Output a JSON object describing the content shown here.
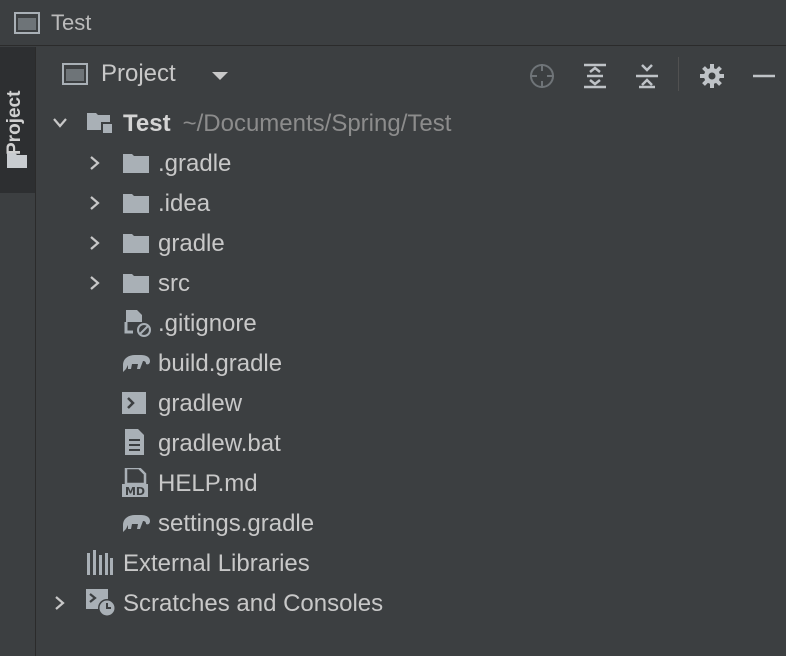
{
  "window": {
    "title": "Test"
  },
  "side_tab": {
    "label": "Project"
  },
  "toolbar": {
    "view_label": "Project"
  },
  "tree": {
    "root": {
      "name": "Test",
      "path": "~/Documents/Spring/Test"
    },
    "items": [
      {
        "label": ".gradle",
        "icon": "folder-icon",
        "expandable": true
      },
      {
        "label": ".idea",
        "icon": "folder-icon",
        "expandable": true
      },
      {
        "label": "gradle",
        "icon": "folder-icon",
        "expandable": true
      },
      {
        "label": "src",
        "icon": "folder-icon",
        "expandable": true
      },
      {
        "label": ".gitignore",
        "icon": "ignore-file-icon",
        "expandable": false
      },
      {
        "label": "build.gradle",
        "icon": "gradle-elephant-icon",
        "expandable": false
      },
      {
        "label": "gradlew",
        "icon": "shell-script-icon",
        "expandable": false
      },
      {
        "label": "gradlew.bat",
        "icon": "text-file-icon",
        "expandable": false
      },
      {
        "label": "HELP.md",
        "icon": "markdown-file-icon",
        "expandable": false
      },
      {
        "label": "settings.gradle",
        "icon": "gradle-elephant-icon",
        "expandable": false
      }
    ],
    "external_libraries": "External Libraries",
    "scratches": "Scratches and Consoles"
  },
  "colors": {
    "background": "#3c3f41",
    "text": "#c8c8c8",
    "path": "#8c8c8c",
    "icon": "#a9b0b6"
  }
}
